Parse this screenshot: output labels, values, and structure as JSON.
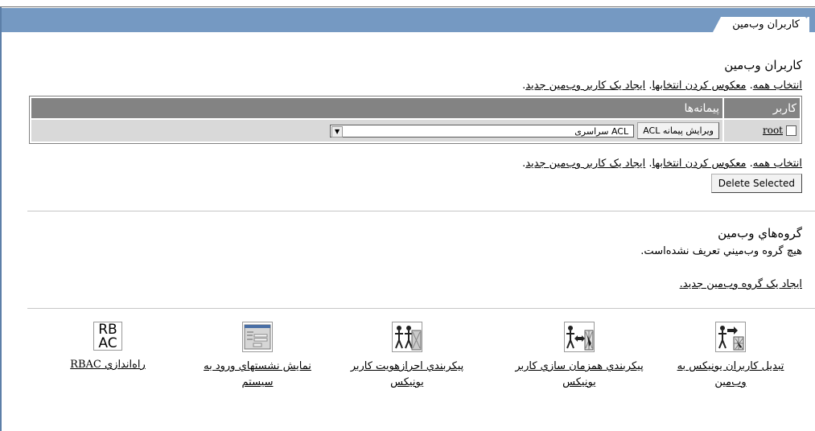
{
  "tab": {
    "label": "کاربران وب‌مين"
  },
  "users_section": {
    "heading": "کاربران وب‌مين",
    "link_select_all": "انتخاب همه",
    "link_invert": "معکوس کردن انتخابها",
    "link_create_user": "ايجاد يک کاربر وب‌مين جديد",
    "link_sep": ". ",
    "link_end": "."
  },
  "table": {
    "headers": {
      "user": "کاربر",
      "modules": "پيمانه‌ها"
    },
    "rows": [
      {
        "user": "root",
        "select_value": "ACL سراسری",
        "edit_button": "ويرايش پيمانه ACL"
      }
    ]
  },
  "delete_button": "Delete Selected",
  "groups_section": {
    "heading": "گروه‌هاي وب‌مين",
    "empty_message": "هيچ گروه وب‌ميني تعريف نشده‌است.",
    "create_link": "ايجاد يک گروه وب‌مين جديد."
  },
  "shortcuts": [
    {
      "icon": "convert-users-icon",
      "label": "تبديل کاربران يونيکس به وب‌مين"
    },
    {
      "icon": "sync-users-icon",
      "label": "پيکربندي همزمان سازي کاربر يونيکس"
    },
    {
      "icon": "unix-auth-icon",
      "label": "پيکربندي احرازهويت کاربر يونيکس"
    },
    {
      "icon": "login-sessions-icon",
      "label": "نمايش نشستهاي ورود به سيستم"
    },
    {
      "icon": "rbac-icon",
      "label": "راه‌اندازي RBAC"
    }
  ],
  "rbac_text": {
    "line1": "RB",
    "line2": "AC"
  }
}
